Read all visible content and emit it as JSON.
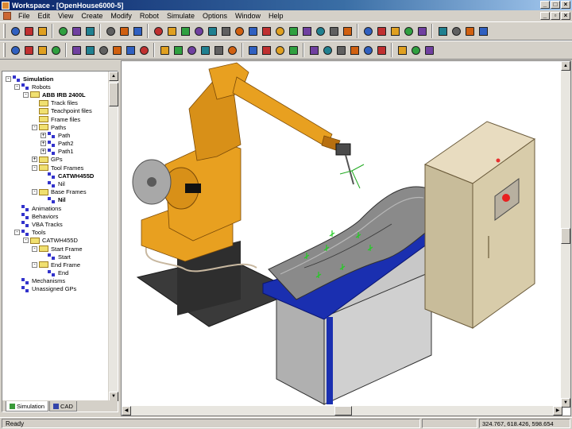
{
  "window": {
    "title": "Workspace - [OpenHouse6000-5]"
  },
  "menu": [
    "File",
    "Edit",
    "View",
    "Create",
    "Modify",
    "Robot",
    "Simulate",
    "Options",
    "Window",
    "Help"
  ],
  "toolbar1": {
    "icons": [
      "new-icon",
      "open-icon",
      "save-icon",
      "cut-icon",
      "copy-icon",
      "paste-icon",
      "print-icon",
      "properties-icon",
      "help-icon",
      "view-front-icon",
      "view-back-icon",
      "view-left-icon",
      "view-right-icon",
      "view-top-icon",
      "view-bottom-icon",
      "pan-icon",
      "rotate-icon",
      "zoom-icon",
      "zoom-in-icon",
      "zoom-out-icon",
      "fit-icon",
      "zoom-window-icon",
      "wireframe-icon",
      "solid-icon",
      "cube-icon",
      "cone-icon",
      "cylinder-icon",
      "sphere-icon",
      "torus-icon",
      "tool-icon",
      "gear-icon",
      "link-icon",
      "wrench-icon"
    ]
  },
  "toolbar2": {
    "icons": [
      "layout-icon",
      "grid-icon",
      "snap-icon",
      "align-icon",
      "teach-icon",
      "frame-icon",
      "move-icon",
      "copy-frame-icon",
      "delete-icon",
      "lock-icon",
      "jog-icon",
      "path-icon",
      "reach-icon",
      "collision-icon",
      "spline-icon",
      "circle-icon",
      "offset-icon",
      "flip-icon",
      "pick-icon",
      "place-icon",
      "line-icon",
      "vertical-icon",
      "arc-icon",
      "curve-icon",
      "bend-icon",
      "measure-icon",
      "record-icon",
      "stop-icon",
      "play-icon"
    ]
  },
  "tree": {
    "items": [
      {
        "label": "Simulation",
        "level": 0,
        "type": "node",
        "expander": "-",
        "bold": true
      },
      {
        "label": "Robots",
        "level": 1,
        "type": "node",
        "expander": "-"
      },
      {
        "label": "ABB IRB 2400L",
        "level": 2,
        "type": "folder",
        "expander": "-",
        "bold": true
      },
      {
        "label": "Track files",
        "level": 3,
        "type": "folder"
      },
      {
        "label": "Teachpoint files",
        "level": 3,
        "type": "folder"
      },
      {
        "label": "Frame files",
        "level": 3,
        "type": "folder"
      },
      {
        "label": "Paths",
        "level": 3,
        "type": "folder",
        "expander": "-"
      },
      {
        "label": "Path",
        "level": 4,
        "type": "node",
        "expander": "+"
      },
      {
        "label": "Path2",
        "level": 4,
        "type": "node",
        "expander": "+"
      },
      {
        "label": "Path1",
        "level": 4,
        "type": "node",
        "expander": "+"
      },
      {
        "label": "GPs",
        "level": 3,
        "type": "folder",
        "expander": "+"
      },
      {
        "label": "Tool Frames",
        "level": 3,
        "type": "folder",
        "expander": "-"
      },
      {
        "label": "CATWH455D",
        "level": 4,
        "type": "node",
        "bold": true
      },
      {
        "label": "Nil",
        "level": 4,
        "type": "node"
      },
      {
        "label": "Base Frames",
        "level": 3,
        "type": "folder",
        "expander": "-"
      },
      {
        "label": "Nil",
        "level": 4,
        "type": "node",
        "bold": true
      },
      {
        "label": "Animations",
        "level": 1,
        "type": "node"
      },
      {
        "label": "Behaviors",
        "level": 1,
        "type": "node"
      },
      {
        "label": "VBA Tracks",
        "level": 1,
        "type": "node"
      },
      {
        "label": "Tools",
        "level": 1,
        "type": "node",
        "expander": "-"
      },
      {
        "label": "CATWH455D",
        "level": 2,
        "type": "folder",
        "expander": "-"
      },
      {
        "label": "Start Frame",
        "level": 3,
        "type": "folder",
        "expander": "-"
      },
      {
        "label": "Start",
        "level": 4,
        "type": "node"
      },
      {
        "label": "End Frame",
        "level": 3,
        "type": "folder",
        "expander": "-"
      },
      {
        "label": "End",
        "level": 4,
        "type": "node"
      },
      {
        "label": "Mechanisms",
        "level": 1,
        "type": "node"
      },
      {
        "label": "Unassigned GPs",
        "level": 1,
        "type": "node"
      }
    ]
  },
  "tabs": [
    {
      "label": "Simulation",
      "active": true
    },
    {
      "label": "CAD",
      "active": false
    }
  ],
  "status": {
    "left": "Ready",
    "coords": "324.767, 618.426, 598.654"
  },
  "colors": {
    "robot": "#e8a020",
    "robot_shade": "#b87010",
    "cabinet": "#d8ccaa",
    "fixture_blue": "#1a2fb0",
    "part": "#7a7a7a",
    "base": "#3a3a3a"
  }
}
